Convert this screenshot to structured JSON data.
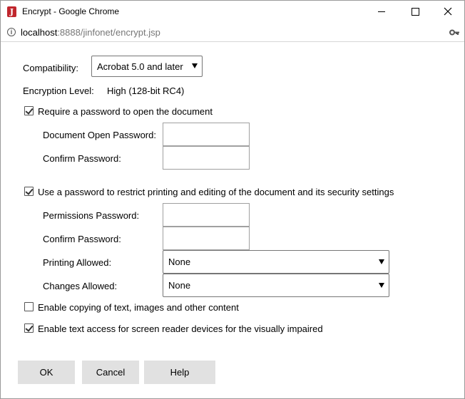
{
  "window": {
    "title": "Encrypt - Google Chrome",
    "app_icon_letter": "J"
  },
  "address": {
    "host": "localhost",
    "rest": ":8888/jinfonet/encrypt.jsp"
  },
  "compatibility": {
    "label": "Compatibility:",
    "value": "Acrobat 5.0 and later"
  },
  "encryption": {
    "label": "Encryption Level:",
    "value": "High (128-bit RC4)"
  },
  "open_password": {
    "checkbox_label": "Require a password to open the document",
    "checked": true,
    "document_open_label": "Document Open Password:",
    "document_open_value": "",
    "confirm_label": "Confirm Password:",
    "confirm_value": ""
  },
  "permissions": {
    "checkbox_label": "Use a password to restrict printing and editing of the document and its security settings",
    "checked": true,
    "permissions_label": "Permissions Password:",
    "permissions_value": "",
    "confirm_label": "Confirm Password:",
    "confirm_value": "",
    "printing_label": "Printing Allowed:",
    "printing_value": "None",
    "changes_label": "Changes Allowed:",
    "changes_value": "None"
  },
  "options": {
    "copying_label": "Enable copying of text, images and other content",
    "copying_checked": false,
    "screen_reader_label": "Enable text access for screen reader devices for the visually impaired",
    "screen_reader_checked": true
  },
  "buttons": {
    "ok": "OK",
    "cancel": "Cancel",
    "help": "Help"
  }
}
